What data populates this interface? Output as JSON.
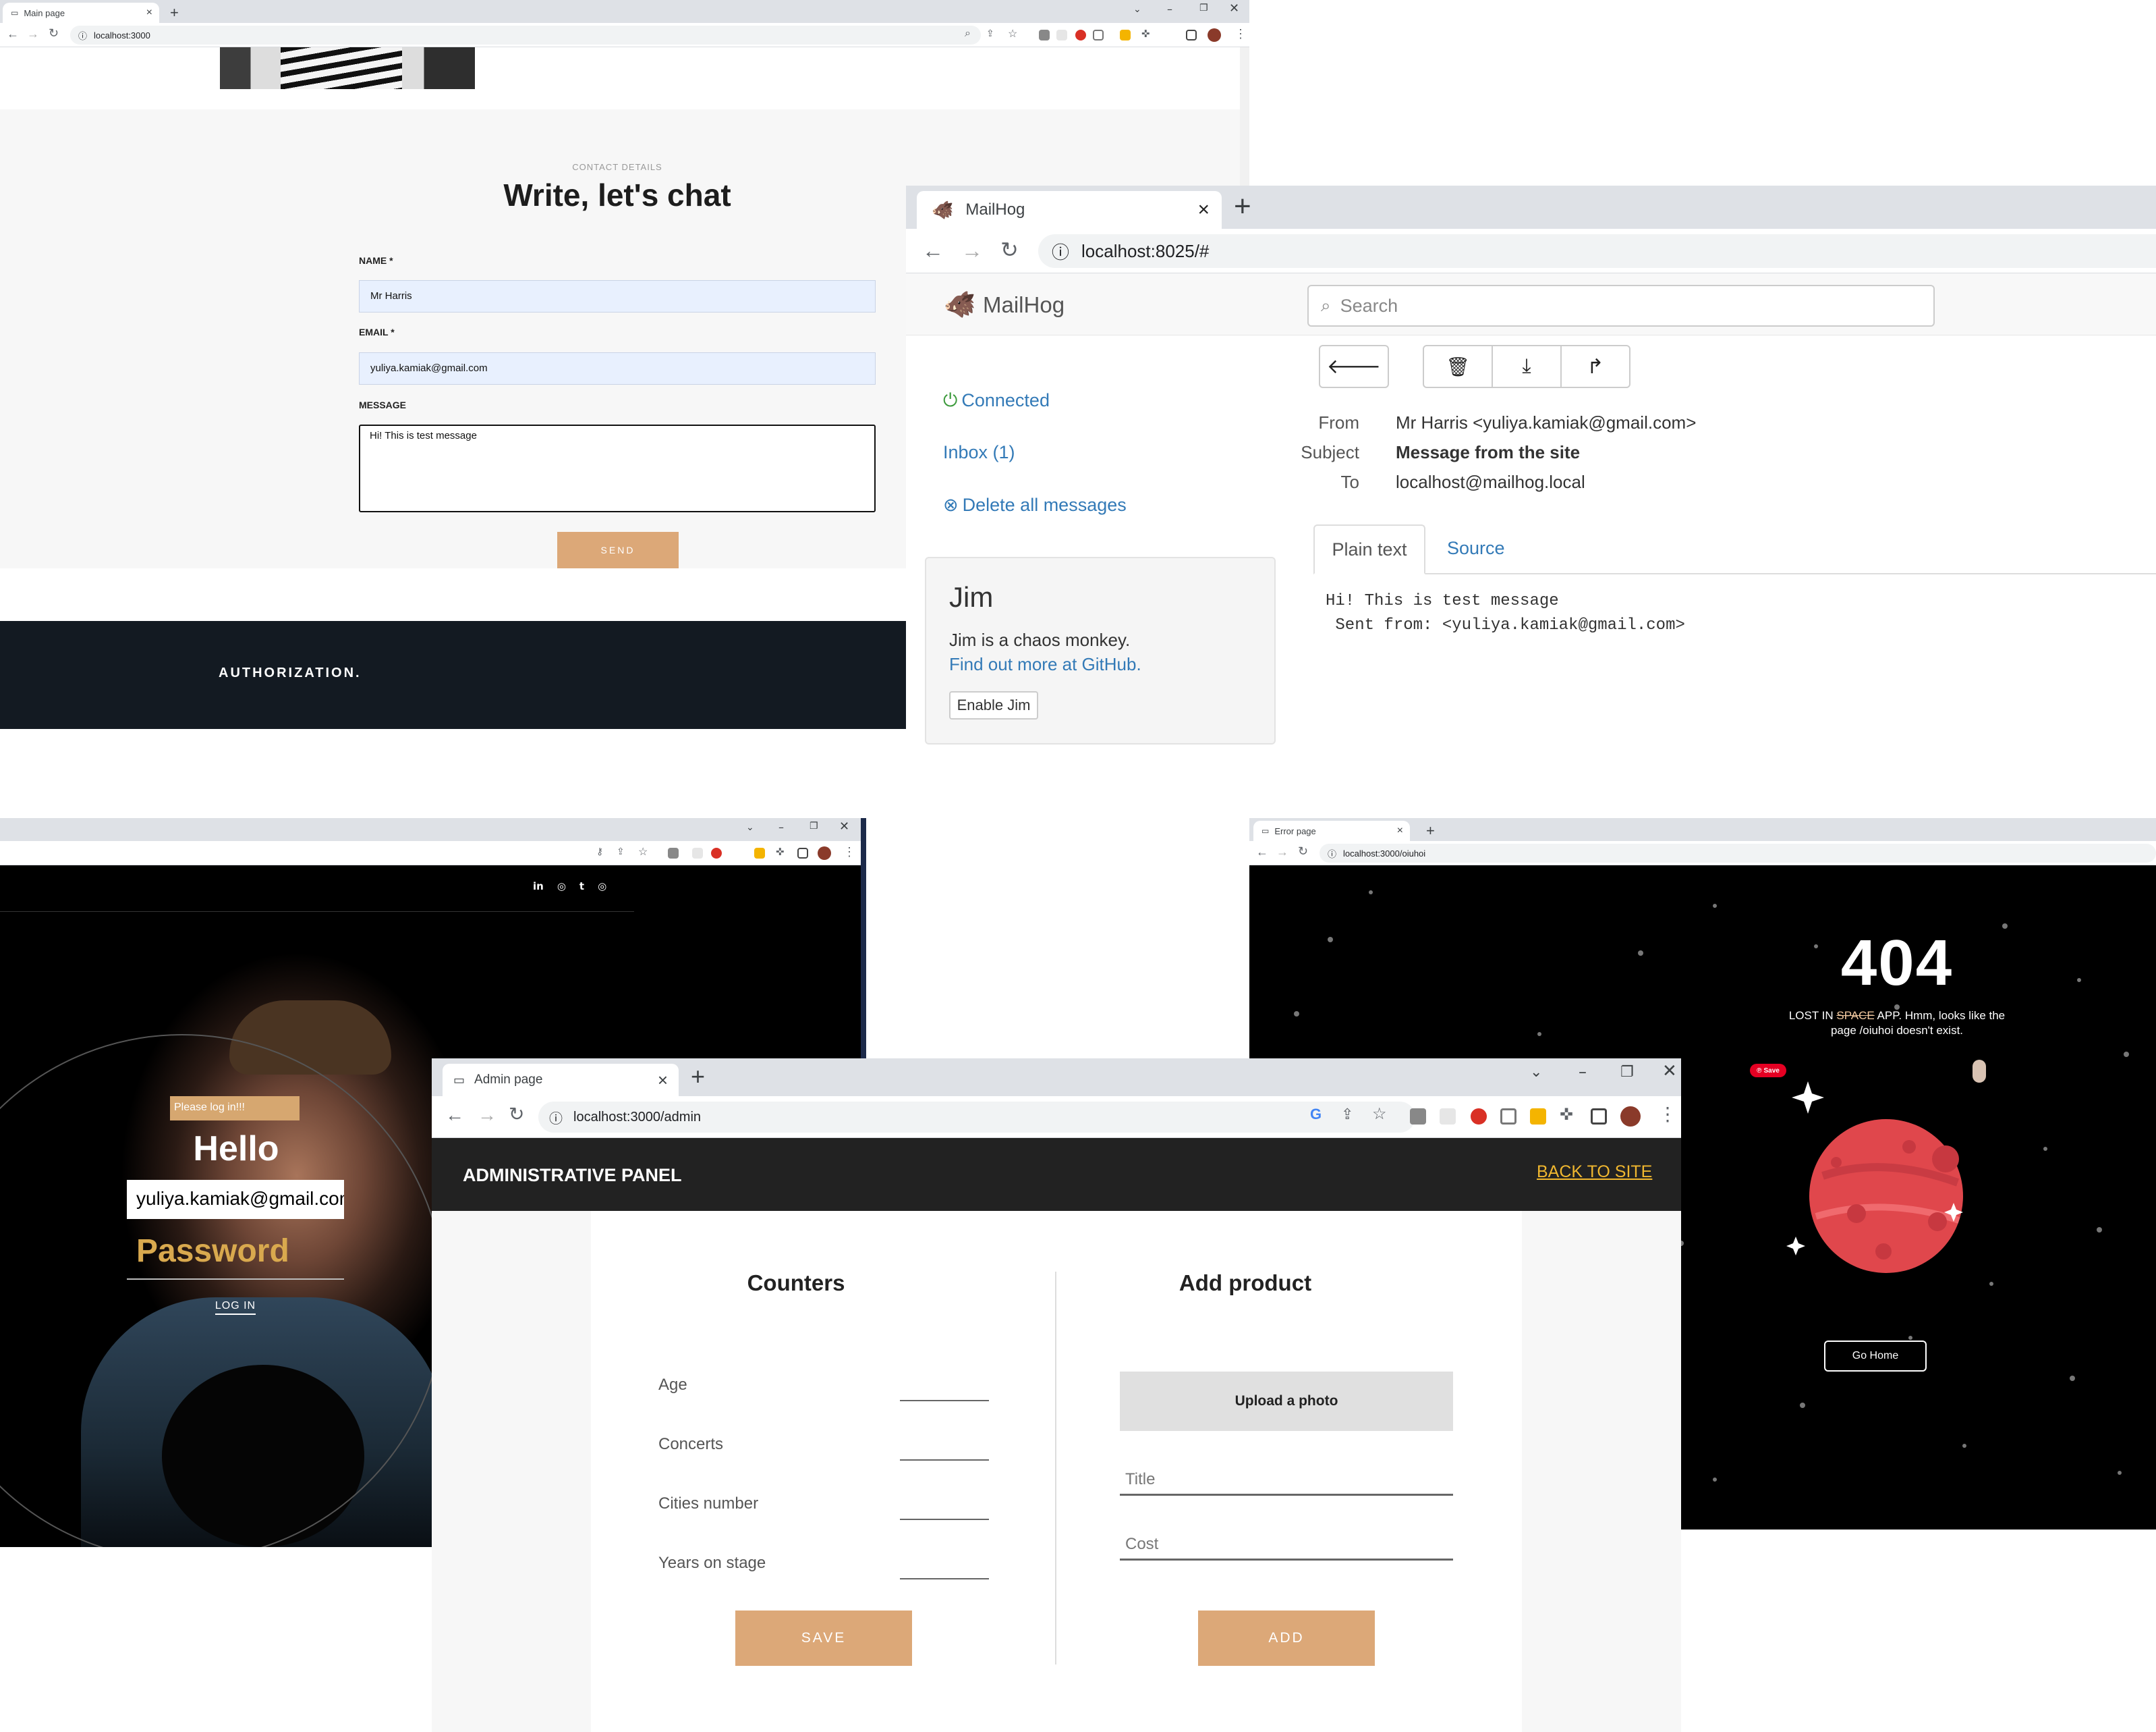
{
  "main_window": {
    "tab_title": "Main page",
    "url": "localhost:3000",
    "contact": {
      "eyebrow": "CONTACT DETAILS",
      "heading": "Write, let's chat",
      "name_label": "NAME *",
      "name_value": "Mr Harris",
      "email_label": "EMAIL *",
      "email_value": "yuliya.kamiak@gmail.com",
      "message_label": "MESSAGE",
      "message_value": "Hi! This is test message",
      "send_label": "SEND"
    },
    "footer_label": "AUTHORIZATION."
  },
  "mailhog_window": {
    "tab_title": "MailHog",
    "url": "localhost:8025/#",
    "brand": "MailHog",
    "search_placeholder": "Search",
    "sidebar": {
      "connected": "Connected",
      "inbox": "Inbox (1)",
      "delete_all": "Delete all messages"
    },
    "jim": {
      "title": "Jim",
      "description": "Jim is a chaos monkey.",
      "link": "Find out more at GitHub.",
      "button": "Enable Jim"
    },
    "message": {
      "from_label": "From",
      "from_value": "Mr Harris <yuliya.kamiak@gmail.com>",
      "subject_label": "Subject",
      "subject_value": "Message from the site",
      "to_label": "To",
      "to_value": "localhost@mailhog.local",
      "tab_plain": "Plain text",
      "tab_source": "Source",
      "body_line1": "Hi! This is test message",
      "body_line2": " Sent from: <yuliya.kamiak@gmail.com>"
    }
  },
  "login_window": {
    "social_icons": [
      "linkedin-icon",
      "discord-icon",
      "tumblr-icon",
      "instagram-icon"
    ],
    "social_glyphs": [
      "in",
      "◎",
      "t",
      "◎"
    ],
    "toast": "Please log in!!!",
    "hello": "Hello",
    "email_value": "yuliya.kamiak@gmail.com",
    "password_placeholder": "Password",
    "login_button": "LOG IN"
  },
  "error_window": {
    "tab_title": "Error page",
    "url": "localhost:3000/oiuhoi",
    "code": "404",
    "message_prefix": "LOST IN ",
    "message_strike": "SPACE",
    "message_suffix": " APP. Hmm, looks like the",
    "message_line2": "page /oiuhoi doesn't exist.",
    "save_badge": "Save",
    "go_home": "Go Home"
  },
  "admin_window": {
    "tab_title": "Admin page",
    "url": "localhost:3000/admin",
    "header_title": "ADMINISTRATIVE PANEL",
    "back_link": "BACK TO SITE",
    "counters": {
      "title": "Counters",
      "fields": [
        "Age",
        "Concerts",
        "Cities number",
        "Years on stage"
      ],
      "save_label": "SAVE"
    },
    "product": {
      "title": "Add product",
      "upload_label": "Upload a photo",
      "title_placeholder": "Title",
      "cost_placeholder": "Cost",
      "add_label": "ADD"
    }
  },
  "colors": {
    "accent_tan": "#dca878",
    "mailhog_blue": "#337ab7",
    "dark_footer": "#131a22",
    "admin_header": "#222222",
    "gold": "#d9a94e",
    "planet_red": "#e0474c"
  }
}
